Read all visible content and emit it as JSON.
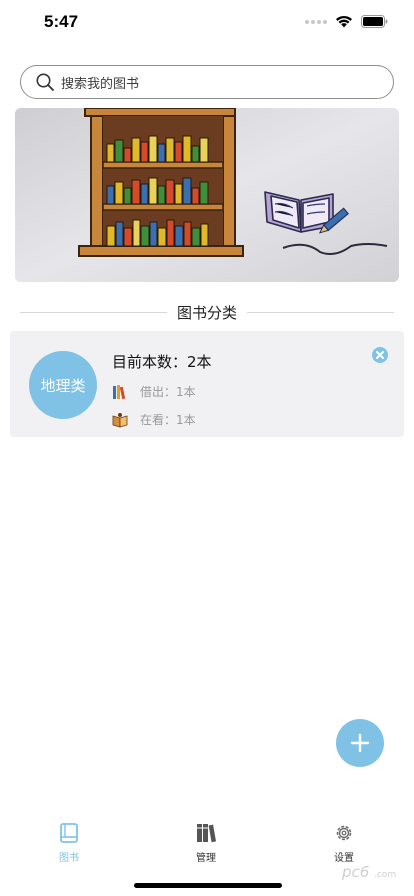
{
  "status_bar": {
    "time": "5:47"
  },
  "search": {
    "placeholder": "搜索我的图书"
  },
  "section": {
    "title": "图书分类"
  },
  "category": {
    "name": "地理类",
    "count_label": "目前本数：",
    "count_value": "2本",
    "borrowed_label": "借出：",
    "borrowed_value": "1本",
    "reading_label": "在看：",
    "reading_value": "1本"
  },
  "tabs": [
    {
      "label": "图书",
      "icon": "book-icon",
      "active": true
    },
    {
      "label": "管理",
      "icon": "books-shelf-icon",
      "active": false
    },
    {
      "label": "设置",
      "icon": "gear-icon",
      "active": false
    }
  ],
  "colors": {
    "accent": "#7fc2e6",
    "tab_inactive": "#555555"
  },
  "watermark": {
    "text": "pc6.com"
  }
}
